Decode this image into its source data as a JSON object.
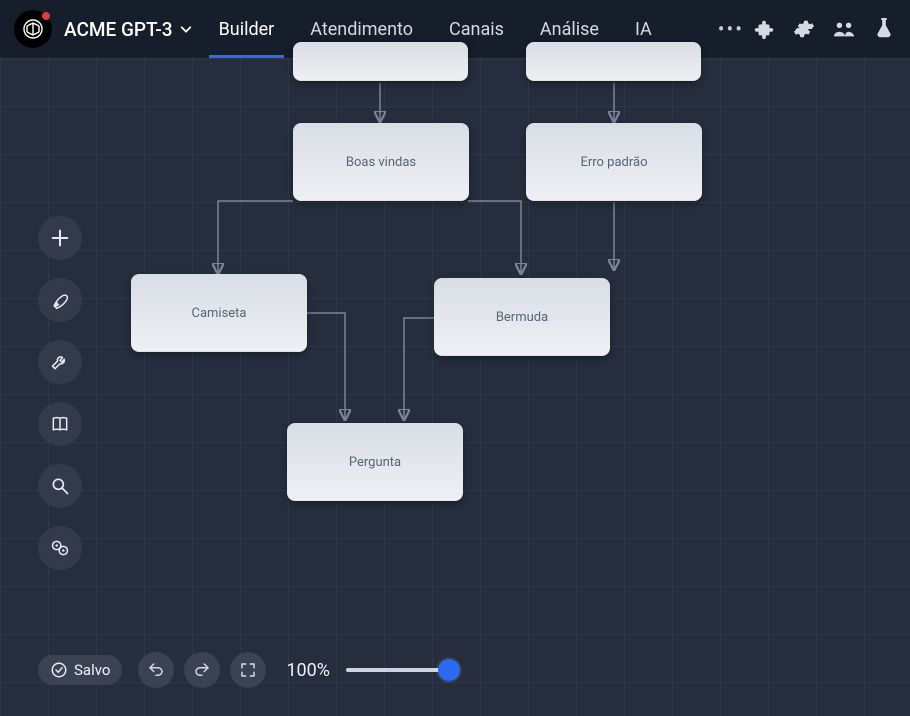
{
  "header": {
    "brand": "ACME GPT-3",
    "tabs": [
      "Builder",
      "Atendimento",
      "Canais",
      "Análise",
      "IA"
    ],
    "active_tab": 0
  },
  "sidebar_tools": [
    "add",
    "rocket",
    "wrench",
    "book",
    "search",
    "cog-circle"
  ],
  "flow": {
    "nodes": [
      {
        "id": "boas",
        "label": "Boas vindas"
      },
      {
        "id": "erro",
        "label": "Erro padrão"
      },
      {
        "id": "cam",
        "label": "Camiseta"
      },
      {
        "id": "berm",
        "label": "Bermuda"
      },
      {
        "id": "perg",
        "label": "Pergunta"
      }
    ]
  },
  "bottom": {
    "status": "Salvo",
    "zoom": "100%"
  },
  "colors": {
    "accent": "#2a6af2",
    "bg": "#262e3e",
    "header": "#161d2b"
  }
}
